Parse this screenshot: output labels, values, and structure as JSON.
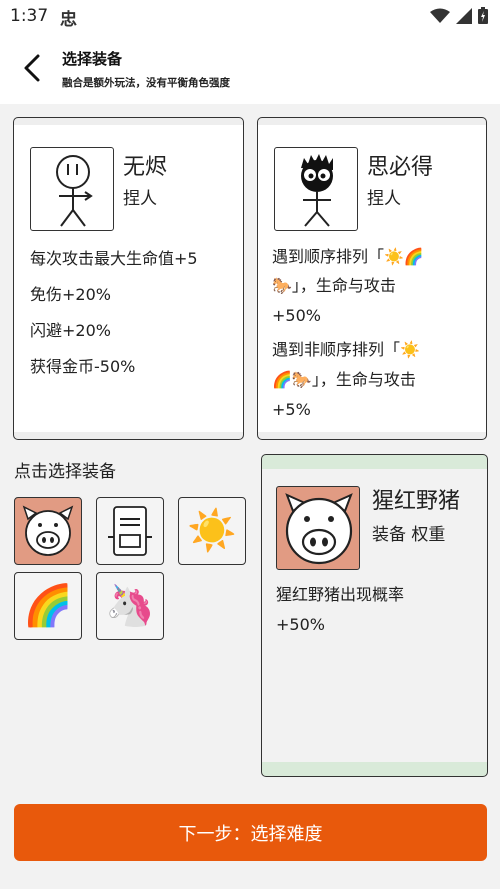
{
  "status_bar": {
    "time": "1:37",
    "app_icon": "忠"
  },
  "header": {
    "title": "选择装备",
    "subtitle": "融合是额外玩法，没有平衡角色强度"
  },
  "characters": [
    {
      "name": "无烬",
      "type": "捏人",
      "effects": [
        "每次攻击最大生命值+5",
        "免伤+20%",
        "闪避+20%",
        "获得金币-50%"
      ]
    },
    {
      "name": "思必得",
      "type": "捏人",
      "effects": [
        "遇到顺序排列「☀️🌈",
        "🐎」，生命与攻击",
        "+50%",
        "遇到非顺序排列「☀️",
        "🌈🐎」，生命与攻击",
        "+5%"
      ]
    }
  ],
  "equip_section": {
    "label": "点击选择装备"
  },
  "equip_slots": [
    {
      "icon": "pig-face-icon",
      "selected": true
    },
    {
      "icon": "robot-face-icon",
      "selected": false
    },
    {
      "icon": "☀️",
      "selected": false
    },
    {
      "icon": "🌈",
      "selected": false
    },
    {
      "icon": "🦄",
      "selected": false
    }
  ],
  "selected_equip": {
    "name": "猩红野猪",
    "tags": "装备 权重",
    "effects": [
      "猩红野猪出现概率",
      "+50%"
    ]
  },
  "next_button": {
    "label": "下一步：选择难度"
  },
  "colors": {
    "accent": "#e8590c",
    "selected_slot": "#e19b83",
    "detail_band": "#d9ead9"
  }
}
